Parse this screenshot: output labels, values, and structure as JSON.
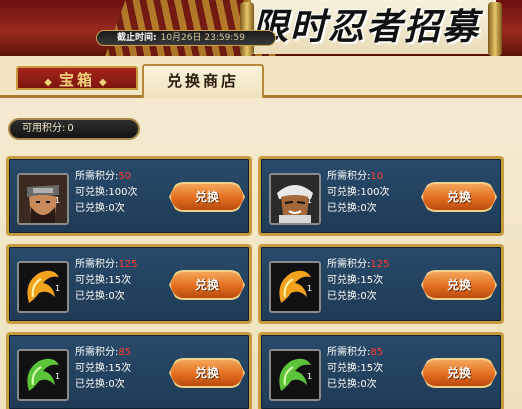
{
  "banner": {
    "title": "限时忍者招募",
    "deadline_label": "截止时间:",
    "deadline_value": "10月26日 23:59:59"
  },
  "tabs": [
    {
      "label": "宝箱",
      "active": false
    },
    {
      "label": "兑换商店",
      "active": true
    }
  ],
  "points": {
    "label": "可用积分:",
    "value": "0"
  },
  "colors": {
    "accent_gold": "#c79c3c",
    "card_blue": "#284a6a",
    "cost_red": "#ff3b30",
    "button_orange": "#e36d1e"
  },
  "items": [
    {
      "icon": "masked-ninja-portrait",
      "qty": "1",
      "cost_label": "所需积分:",
      "cost": "50",
      "limit_label": "可兑换:",
      "limit": "100次",
      "used_label": "已兑换:",
      "used": "0次",
      "button": "兑换"
    },
    {
      "icon": "white-haired-ninja-portrait",
      "qty": "1",
      "cost_label": "所需积分:",
      "cost": "10",
      "limit_label": "可兑换:",
      "limit": "100次",
      "used_label": "已兑换:",
      "used": "0次",
      "button": "兑换"
    },
    {
      "icon": "orange-swirl-scroll-icon",
      "qty": "1",
      "cost_label": "所需积分:",
      "cost": "125",
      "limit_label": "可兑换:",
      "limit": "15次",
      "used_label": "已兑换:",
      "used": "0次",
      "button": "兑换"
    },
    {
      "icon": "orange-swirl-scroll-icon",
      "qty": "1",
      "cost_label": "所需积分:",
      "cost": "125",
      "limit_label": "可兑换:",
      "limit": "15次",
      "used_label": "已兑换:",
      "used": "0次",
      "button": "兑换"
    },
    {
      "icon": "green-swirl-scroll-icon",
      "qty": "1",
      "cost_label": "所需积分:",
      "cost": "85",
      "limit_label": "可兑换:",
      "limit": "15次",
      "used_label": "已兑换:",
      "used": "0次",
      "button": "兑换"
    },
    {
      "icon": "green-swirl-scroll-icon",
      "qty": "1",
      "cost_label": "所需积分:",
      "cost": "85",
      "limit_label": "可兑换:",
      "limit": "15次",
      "used_label": "已兑换:",
      "used": "0次",
      "button": "兑换"
    }
  ]
}
